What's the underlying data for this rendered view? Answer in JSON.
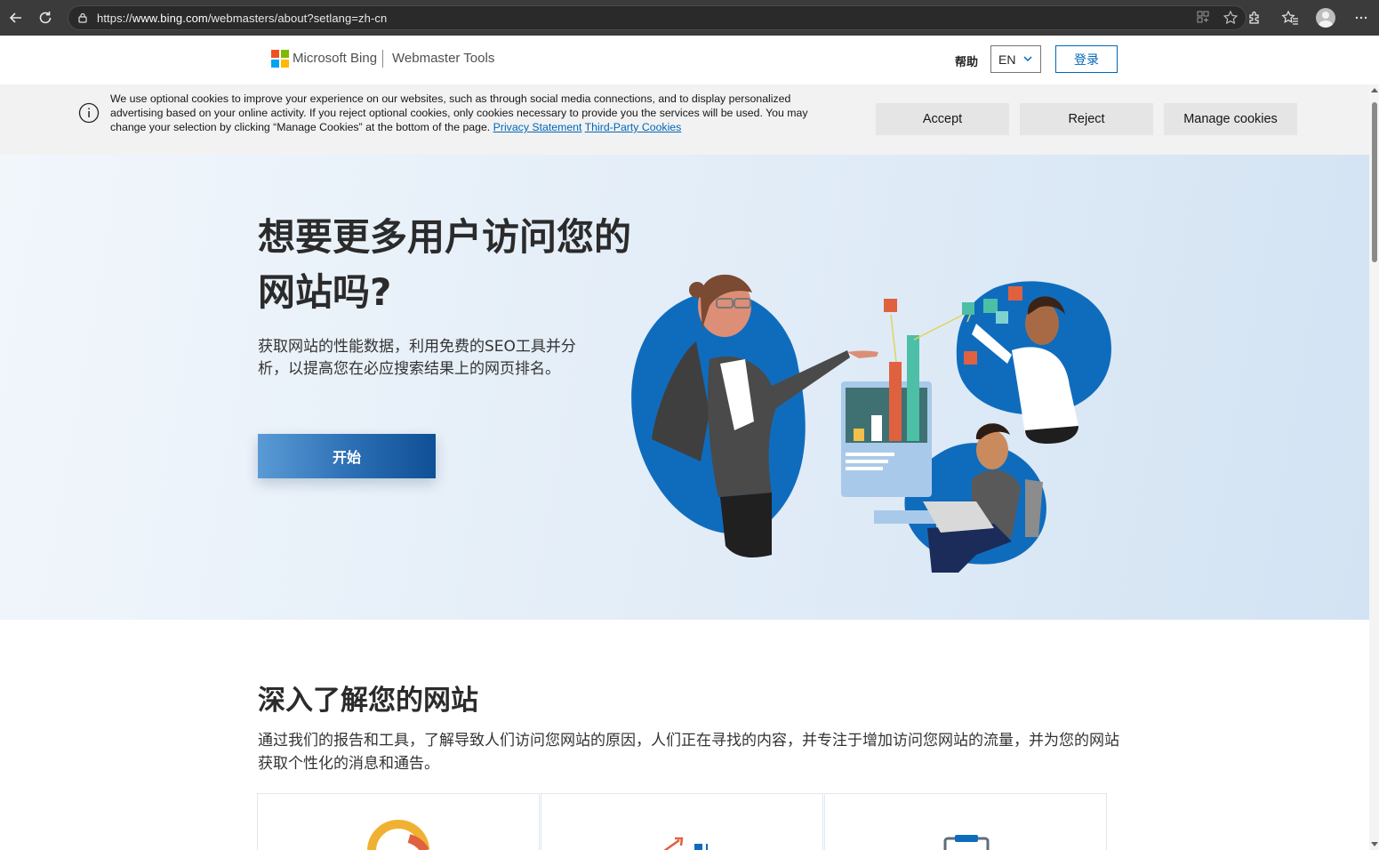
{
  "browser": {
    "url_prefix": "https://",
    "url_host": "www.bing.com",
    "url_path": "/webmasters/about?setlang=zh-cn"
  },
  "header": {
    "brand": "Microsoft Bing",
    "product": "Webmaster Tools",
    "help": "帮助",
    "language": "EN",
    "signin": "登录"
  },
  "cookie_banner": {
    "text": "We use optional cookies to improve your experience on our websites, such as through social media connections, and to display personalized advertising based on your online activity. If you reject optional cookies, only cookies necessary to provide you the services will be used. You may change your selection by clicking “Manage Cookies” at the bottom of the page.",
    "privacy_link": "Privacy Statement",
    "third_party_link": "Third-Party Cookies",
    "accept": "Accept",
    "reject": "Reject",
    "manage": "Manage cookies"
  },
  "hero": {
    "title": "想要更多用户访问您的网站吗?",
    "description": "获取网站的性能数据，利用免费的SEO工具并分析，以提高您在必应搜索结果上的网页排名。",
    "cta": "开始"
  },
  "section": {
    "title": "深入了解您的网站",
    "description": "通过我们的报告和工具，了解导致人们访问您网站的原因，人们正在寻找的内容，并专注于增加访问您网站的流量，并为您的网站获取个性化的消息和通告。"
  },
  "icons": [
    "back-icon",
    "refresh-icon",
    "lock-icon",
    "reader-icon",
    "favorite-icon",
    "extensions-icon",
    "favorites-icon",
    "profile-icon",
    "more-icon",
    "info-icon",
    "chevron-down-icon"
  ],
  "colors": {
    "accent": "#0067b8",
    "ms_red": "#f25022",
    "ms_green": "#7fba00",
    "ms_blue": "#00a4ef",
    "ms_yellow": "#ffb900"
  }
}
